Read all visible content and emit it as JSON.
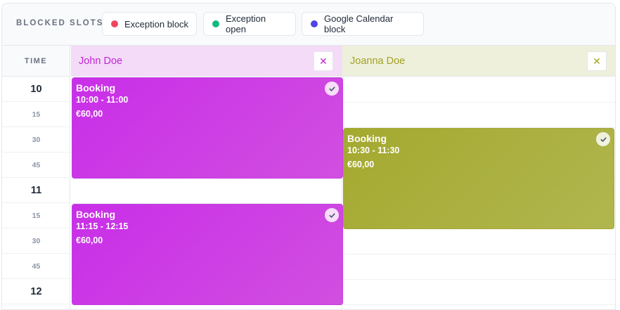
{
  "legend": {
    "title": "BLOCKED SLOTS",
    "items": [
      {
        "label": "Exception block",
        "color": "#ef4460"
      },
      {
        "label": "Exception open",
        "color": "#10b981"
      },
      {
        "label": "Google Calendar block",
        "color": "#4f46e5"
      }
    ]
  },
  "grid": {
    "time_header": "TIME",
    "times": [
      "10",
      "15",
      "30",
      "45",
      "11",
      "15",
      "30",
      "45",
      "12"
    ]
  },
  "resources": [
    {
      "name": "John Doe",
      "header_bg": "#f4dbf8",
      "text_color": "#c026d3",
      "close_glyph": "✕"
    },
    {
      "name": "Joanna Doe",
      "header_bg": "#eef0dc",
      "text_color": "#a3a320",
      "close_glyph": "✕"
    }
  ],
  "bookings": [
    {
      "title": "Booking",
      "time": "10:00 - 11:00",
      "price": "€60,00",
      "color": "#c92ee8",
      "confirmed": true
    },
    {
      "title": "Booking",
      "time": "11:15 - 12:15",
      "price": "€60,00",
      "color": "#c92ee8",
      "confirmed": true
    },
    {
      "title": "Booking",
      "time": "10:30 - 11:30",
      "price": "€60,00",
      "color": "#a4a92f",
      "confirmed": true
    }
  ]
}
